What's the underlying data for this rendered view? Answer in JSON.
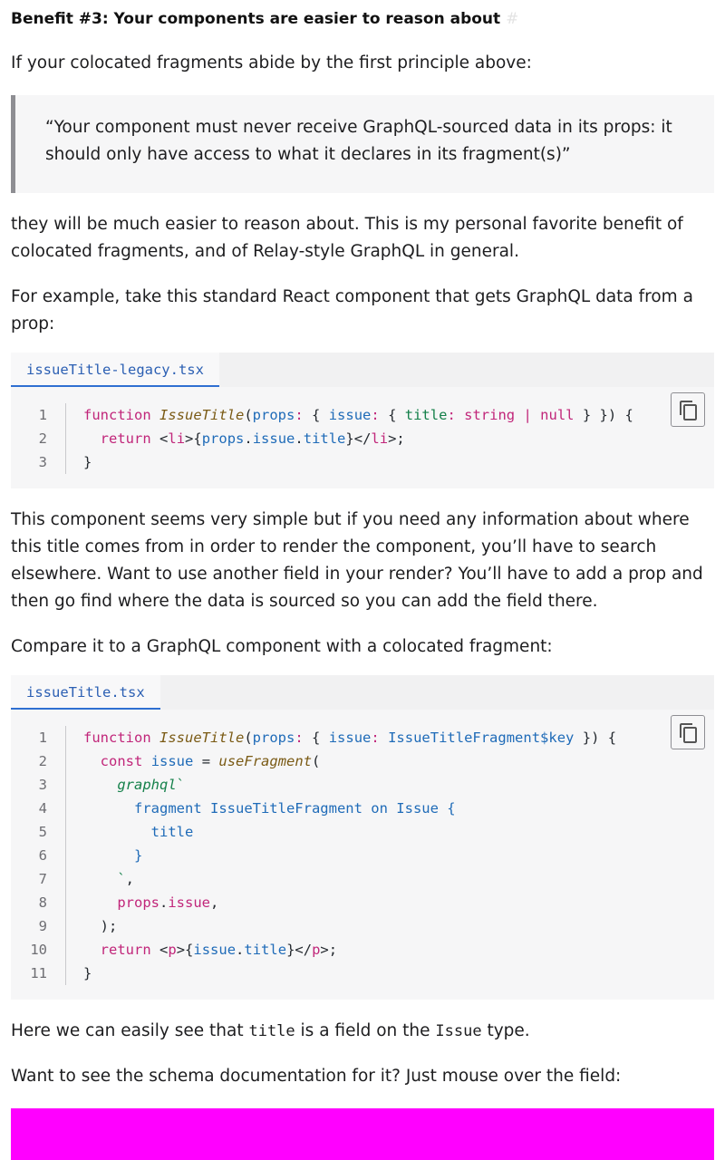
{
  "heading": {
    "text": "Benefit #3: Your components are easier to reason about",
    "anchor": "#"
  },
  "intro": "If your colocated fragments abide by the first principle above:",
  "quote": "“Your component must never receive GraphQL-sourced data in its props: it should only have access to what it declares in its fragment(s)”",
  "para_after_quote": "they will be much easier to reason about. This is my personal favorite benefit of colocated fragments, and of Relay-style GraphQL in general.",
  "para_example": "For example, take this standard React component that gets GraphQL data from a prop:",
  "code1": {
    "filename": "issueTitle-legacy.tsx",
    "copy_icon": "copy-icon",
    "line_numbers": [
      "1",
      "2",
      "3"
    ]
  },
  "para_explain": "This component seems very simple but if you need any information about where this title comes from in order to render the component, you’ll have to search elsewhere. Want to use another field in your render? You’ll have to add a prop and then go find where the data is sourced so you can add the field there.",
  "para_compare": "Compare it to a GraphQL component with a colocated fragment:",
  "code2": {
    "filename": "issueTitle.tsx",
    "copy_icon": "copy-icon",
    "line_numbers": [
      "1",
      "2",
      "3",
      "4",
      "5",
      "6",
      "7",
      "8",
      "9",
      "10",
      "11"
    ]
  },
  "para_see": {
    "pre": "Here we can easily see that ",
    "code1": "title",
    "mid": " is a field on the ",
    "code2": "Issue",
    "post": " type."
  },
  "para_mouse": "Want to see the schema documentation for it? Just mouse over the field:",
  "colors": {
    "keyword": "#c1267a",
    "type": "#14804a",
    "prop": "#1f6bb8",
    "function": "#7a5a14",
    "placeholder": "#ff00ff"
  }
}
